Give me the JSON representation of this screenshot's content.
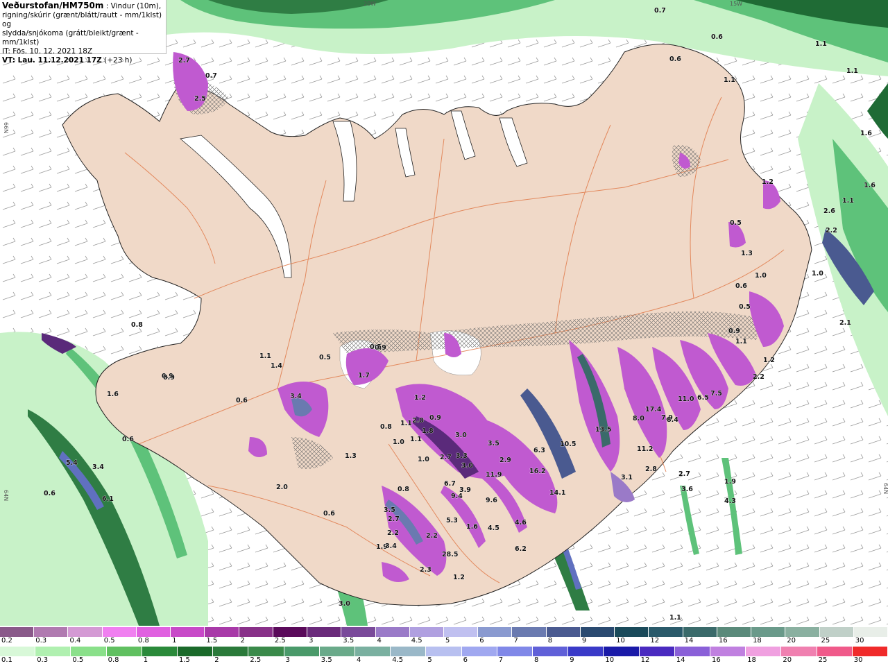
{
  "header": {
    "title": "Veðurstofan/HM750m",
    "subtitle_line1": " : Vindur (10m),",
    "subtitle_line2": "rigning/skúrir (grænt/blátt/rautt - mm/1klst) og",
    "subtitle_line3": "slydda/snjókoma (grátt/bleikt/grænt - mm/1klst)",
    "it_line": "IT: Fös. 10. 12. 2021 18Z",
    "vt_line": "VT: Lau. 11.12.2021 17Z",
    "vt_offset": " (+23 h)"
  },
  "coords": {
    "top_left": "20W",
    "top_right": "15W",
    "left_upper": "66N",
    "left_lower": "64N",
    "right_lower": "64N"
  },
  "colors": {
    "sea": "#ffffff",
    "land": "#f0d9c8",
    "roads": "#e07a4a",
    "rain_light": "#c8f2c8",
    "rain_mid": "#5ec27a",
    "rain_dark": "#1f6b35",
    "snow_light": "#e39ae6",
    "snow_mid": "#b34fc4",
    "snow_dark": "#5a2a7a"
  },
  "precip_values": [
    "0.7",
    "0.6",
    "1.1",
    "1.1",
    "1.6",
    "2.5",
    "2.7",
    "0.7",
    "0.6",
    "1.1",
    "1.6",
    "1.1",
    "1.2",
    "2.6",
    "2.2",
    "0.5",
    "1.3",
    "1.0",
    "0.6",
    "0.5",
    "2.1",
    "1.0",
    "0.9",
    "1.1",
    "1.2",
    "0.6",
    "0.8",
    "1.1",
    "1.4",
    "0.9",
    "0.5",
    "3.4",
    "1.7",
    "0.5",
    "1.2",
    "2.0",
    "0.9",
    "1.1",
    "1.0",
    "1.1",
    "1.8",
    "3.0",
    "3.5",
    "6.3",
    "10.5",
    "13.5",
    "8.0",
    "17.4",
    "7.9",
    "11.0",
    "6.5",
    "7.5",
    "2.2",
    "16.2",
    "14.1",
    "11.2",
    "8.4",
    "3.1",
    "2.8",
    "2.7",
    "3.6",
    "1.9",
    "4.3",
    "2.9",
    "11.9",
    "3.9",
    "9.6",
    "4.6",
    "4.5",
    "6.2",
    "9.4",
    "6.7",
    "3.0",
    "3.3",
    "2.7",
    "1.0",
    "0.6",
    "2.0",
    "3.5",
    "2.7",
    "2.2",
    "1.9",
    "3.4",
    "2.3",
    "2.2",
    "28.5",
    "5.3",
    "1.6",
    "1.2",
    "0.8",
    "1.3",
    "1.6",
    "0.9",
    "0.6",
    "5.4",
    "3.4",
    "6.1",
    "0.6",
    "3.0",
    "1.1",
    "0.8",
    "0.9"
  ],
  "legend": {
    "snow": {
      "labels": [
        "0.2",
        "0.3",
        "0.4",
        "0.5",
        "0.8",
        "1",
        "1.5",
        "2",
        "2.5",
        "3",
        "3.5",
        "4",
        "4.5",
        "5",
        "6",
        "7",
        "8",
        "9",
        "10",
        "12",
        "14",
        "16",
        "18",
        "20",
        "25",
        "30"
      ],
      "colors": [
        "#8a5a8a",
        "#b07ab0",
        "#d49ad4",
        "#f080f0",
        "#e060e0",
        "#c84ac8",
        "#a83aa8",
        "#883088",
        "#5a0a5a",
        "#6a2a7a",
        "#7a4a9a",
        "#9a7ac8",
        "#b0a0e0",
        "#c0c0f0",
        "#8a9ad0",
        "#6a7ab0",
        "#4a5a90",
        "#2a4a70",
        "#1a4a5a",
        "#2a5a6a",
        "#3a6a6a",
        "#5a8a7a",
        "#6a9a8a",
        "#8ab0a0",
        "#c0d0c8",
        "#e8eee8"
      ]
    },
    "rain": {
      "labels": [
        "0.1",
        "0.3",
        "0.5",
        "0.8",
        "1",
        "1.5",
        "2",
        "2.5",
        "3",
        "3.5",
        "4",
        "4.5",
        "5",
        "6",
        "7",
        "8",
        "9",
        "10",
        "12",
        "14",
        "16",
        "18",
        "20",
        "25",
        "30"
      ],
      "colors": [
        "#d8f8d8",
        "#b0f0b0",
        "#8ae08a",
        "#60c060",
        "#2a8a3a",
        "#1a6a2a",
        "#2a7a3a",
        "#3a8a4a",
        "#4a9a6a",
        "#6aaa8a",
        "#7ab0a0",
        "#9ab8c8",
        "#b8c0f0",
        "#a0a8f0",
        "#8088e8",
        "#6060d8",
        "#3a3ac8",
        "#1a1aa8",
        "#4a2ac0",
        "#8a60d8",
        "#c080e0",
        "#f0a0e0",
        "#f080b0",
        "#f05a8a",
        "#f02a2a"
      ]
    }
  }
}
